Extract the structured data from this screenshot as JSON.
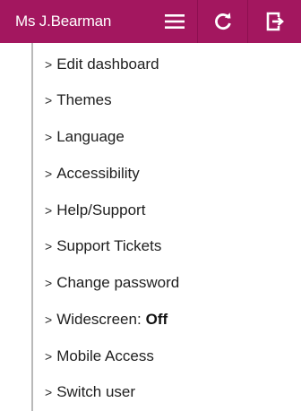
{
  "header": {
    "user_name": "Ms J.Bearman",
    "bar_color": "#a3175f",
    "icons": [
      "menu-icon",
      "refresh-icon",
      "logout-icon"
    ]
  },
  "menu": {
    "chevron": ">",
    "items": [
      {
        "label": "Edit dashboard"
      },
      {
        "label": "Themes"
      },
      {
        "label": "Language"
      },
      {
        "label": "Accessibility"
      },
      {
        "label": "Help/Support"
      },
      {
        "label": "Support Tickets"
      },
      {
        "label": "Change password"
      },
      {
        "label": "Widescreen:",
        "state": "Off"
      },
      {
        "label": "Mobile Access"
      },
      {
        "label": "Switch user"
      }
    ]
  }
}
